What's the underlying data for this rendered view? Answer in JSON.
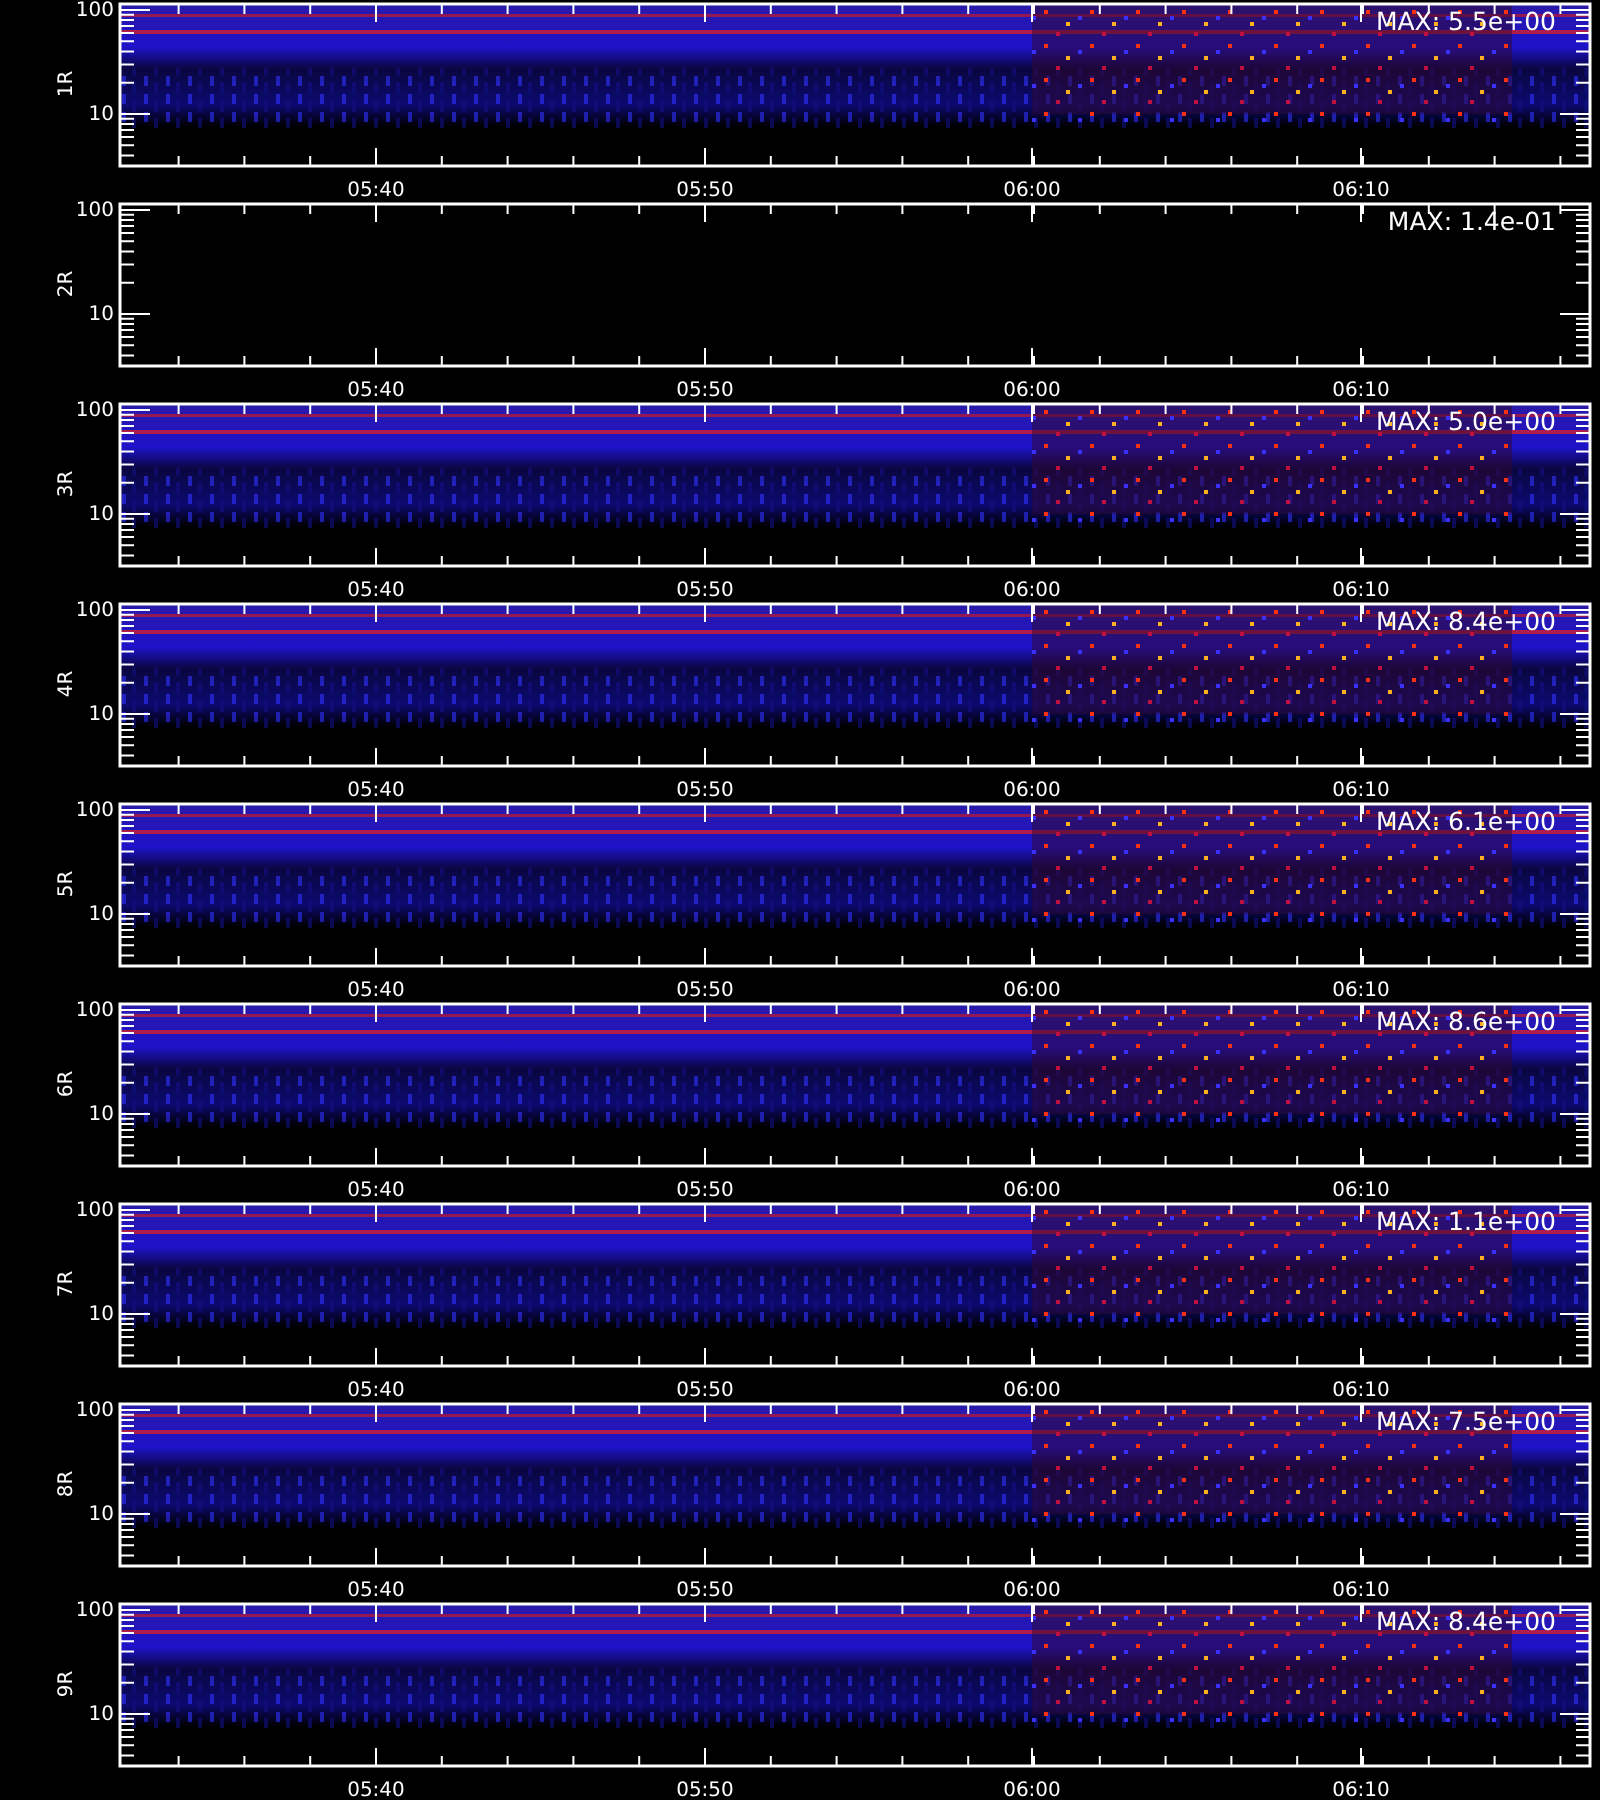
{
  "panels": [
    {
      "label": "1R",
      "max": "MAX: 5.5e+00",
      "kind": "picture",
      "yticks": [
        "100",
        "10"
      ],
      "xticks": [
        "05:40",
        "05:50",
        "06:00",
        "06:10"
      ]
    },
    {
      "label": "2R",
      "max": "MAX: 1.4e-01",
      "kind": "empty",
      "yticks": [
        "100",
        "10"
      ],
      "xticks": [
        "05:40",
        "05:50",
        "06:00",
        "06:10"
      ]
    },
    {
      "label": "3R",
      "max": "MAX: 5.0e+00",
      "kind": "picture",
      "yticks": [
        "100",
        "10"
      ],
      "xticks": [
        "05:40",
        "05:50",
        "06:00",
        "06:10"
      ]
    },
    {
      "label": "4R",
      "max": "MAX: 8.4e+00",
      "kind": "picture",
      "yticks": [
        "100",
        "10"
      ],
      "xticks": [
        "05:40",
        "05:50",
        "06:00",
        "06:10"
      ]
    },
    {
      "label": "5R",
      "max": "MAX: 6.1e+00",
      "kind": "picture",
      "yticks": [
        "100",
        "10"
      ],
      "xticks": [
        "05:40",
        "05:50",
        "06:00",
        "06:10"
      ]
    },
    {
      "label": "6R",
      "max": "MAX: 8.6e+00",
      "kind": "picture",
      "yticks": [
        "100",
        "10"
      ],
      "xticks": [
        "05:40",
        "05:50",
        "06:00",
        "06:10"
      ]
    },
    {
      "label": "7R",
      "max": "MAX: 1.1e+00",
      "kind": "picture",
      "yticks": [
        "100",
        "10"
      ],
      "xticks": [
        "05:40",
        "05:50",
        "06:00",
        "06:10"
      ]
    },
    {
      "label": "8R",
      "max": "MAX: 7.5e+00",
      "kind": "picture",
      "yticks": [
        "100",
        "10"
      ],
      "xticks": [
        "05:40",
        "05:50",
        "06:00",
        "06:10"
      ]
    },
    {
      "label": "9R",
      "max": "MAX: 8.4e+00",
      "kind": "picture",
      "yticks": [
        "100",
        "10"
      ],
      "xticks": [
        "05:40",
        "05:50",
        "06:00",
        "06:10"
      ]
    }
  ]
}
